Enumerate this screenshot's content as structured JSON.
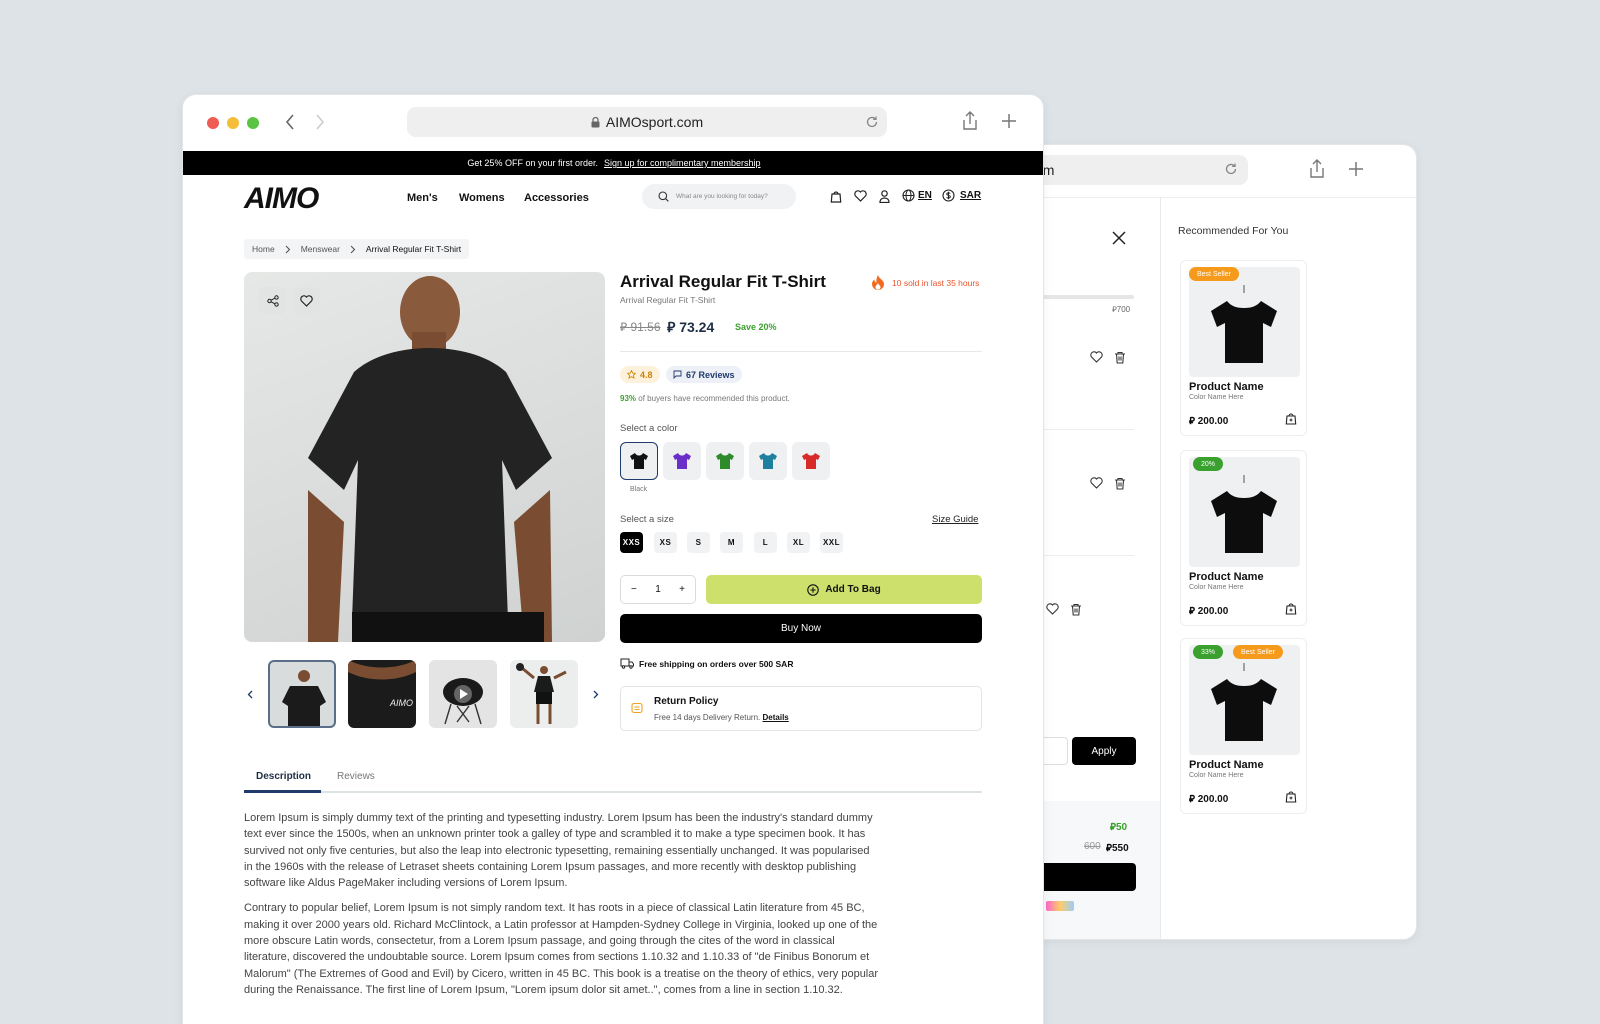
{
  "back_window": {
    "url_partial": "com",
    "progress_label": "⃁700",
    "apply_button": "Apply",
    "discount_value": "⃁50",
    "old_total": "600",
    "new_total": "⃁550",
    "recommended": {
      "title": "Recommended For You",
      "cards": [
        {
          "badges": [
            "Best Seller"
          ],
          "name": "Product Name",
          "color": "Color Name Here",
          "price": "⃁ 200.00"
        },
        {
          "badges": [
            "20%"
          ],
          "name": "Product Name",
          "color": "Color Name Here",
          "price": "⃁ 200.00"
        },
        {
          "badges": [
            "33%",
            "Best Seller"
          ],
          "name": "Product Name",
          "color": "Color Name Here",
          "price": "⃁ 200.00"
        }
      ]
    }
  },
  "front_window": {
    "url": "AIMOsport.com",
    "promo": {
      "text": "Get 25% OFF on your first order.",
      "link": "Sign up for complimentary membership"
    },
    "header": {
      "logo": "AIMO",
      "nav": [
        "Men's",
        "Womens",
        "Accessories"
      ],
      "search_placeholder": "What are you looking for today?",
      "lang": "EN",
      "currency": "SAR"
    },
    "breadcrumb": [
      "Home",
      "Menswear",
      "Arrival Regular Fit T-Shirt"
    ],
    "product": {
      "title": "Arrival Regular Fit T-Shirt",
      "subtitle": "Arrival Regular Fit T-Shirt",
      "sold_text": "10 sold in last 35 hours",
      "old_price": "⃁ 91.56",
      "price": "⃁ 73.24",
      "save": "Save 20%",
      "rating": "4.8",
      "reviews": "67 Reviews",
      "recommend_pct": "93%",
      "recommend_text": "of buyers have recommended this product.",
      "color_label": "Select a color",
      "colors": [
        {
          "name": "Black",
          "hex": "#111111"
        },
        {
          "name": "Purple",
          "hex": "#6a2ec9"
        },
        {
          "name": "Green",
          "hex": "#2f8a2b"
        },
        {
          "name": "Teal",
          "hex": "#1f7f9e"
        },
        {
          "name": "Red",
          "hex": "#d92a2a"
        }
      ],
      "selected_color": "Black",
      "size_label": "Select a size",
      "size_guide": "Size Guide",
      "sizes": [
        "XXS",
        "XS",
        "S",
        "M",
        "L",
        "XL",
        "XXL"
      ],
      "selected_size": "XXS",
      "qty": "1",
      "add_to_bag": "Add To Bag",
      "buy_now": "Buy Now",
      "shipping": "Free shipping on orders over 500 SAR",
      "return_title": "Return Policy",
      "return_text": "Free 14 days Delivery Return.",
      "return_link": "Details"
    },
    "tabs": [
      "Description",
      "Reviews"
    ],
    "description": [
      "Lorem Ipsum is simply dummy text of the printing and typesetting industry. Lorem Ipsum has been the industry's standard dummy text ever since the 1500s, when an unknown printer took a galley of type and scrambled it to make a type specimen book. It has survived not only five centuries, but also the leap into electronic typesetting, remaining essentially unchanged. It was popularised in the 1960s with the release of Letraset sheets containing Lorem Ipsum passages, and more recently with desktop publishing software like Aldus PageMaker including versions of Lorem Ipsum.",
      "Contrary to popular belief, Lorem Ipsum is not simply random text. It has roots in a piece of classical Latin literature from 45 BC, making it over 2000 years old. Richard McClintock, a Latin professor at Hampden-Sydney College in Virginia, looked up one of the more obscure Latin words, consectetur, from a Lorem Ipsum passage, and going through the cites of the word in classical literature, discovered the undoubtable source. Lorem Ipsum comes from sections 1.10.32 and 1.10.33 of \"de Finibus Bonorum et Malorum\" (The Extremes of Good and Evil) by Cicero, written in 45 BC. This book is a treatise on the theory of ethics, very popular during the Renaissance. The first line of Lorem Ipsum, \"Lorem ipsum dolor sit amet..\", comes from a line in section 1.10.32."
    ]
  }
}
